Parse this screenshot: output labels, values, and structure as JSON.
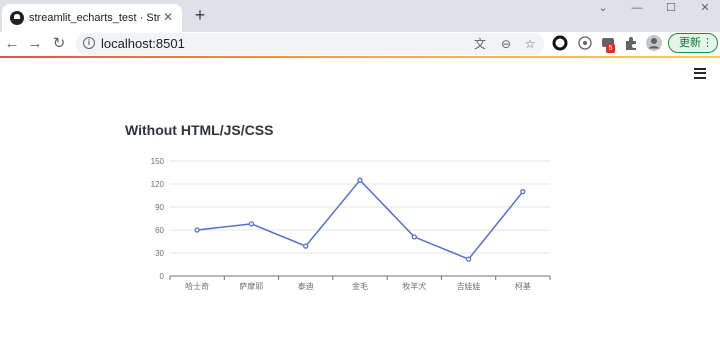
{
  "browser": {
    "tab_title": "streamlit_echarts_test · Streamlit",
    "url": "localhost:8501",
    "update_label": "更新",
    "extension_badge": "5"
  },
  "page": {
    "title": "Without HTML/JS/CSS"
  },
  "chart_data": {
    "type": "line",
    "categories": [
      "哈士奇",
      "萨摩耶",
      "泰迪",
      "金毛",
      "牧羊犬",
      "吉娃娃",
      "柯基"
    ],
    "values": [
      60,
      68,
      39,
      125,
      51,
      22,
      110
    ],
    "yticks": [
      0,
      30,
      60,
      90,
      120,
      150
    ],
    "ylim": [
      0,
      150
    ],
    "grid": true,
    "line_color": "#5470c6"
  }
}
